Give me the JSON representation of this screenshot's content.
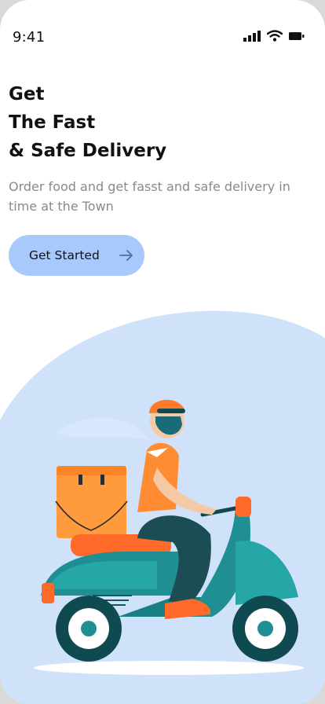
{
  "status_bar": {
    "time": "9:41",
    "icons": [
      "cellular-signal-icon",
      "wifi-icon",
      "battery-icon"
    ]
  },
  "hero": {
    "headline": [
      "Get",
      "The Fast",
      "& Safe Delivery"
    ],
    "subtitle": "Order food and get fasst and safe delivery in time at the Town"
  },
  "cta": {
    "label": "Get Started",
    "icon": "arrow-right-icon"
  },
  "colors": {
    "accent": "#a7c9fb",
    "backdrop_blob": "#cfe2fa",
    "courier_orange": "#ff8c33",
    "scooter_teal": "#1f8f94"
  }
}
